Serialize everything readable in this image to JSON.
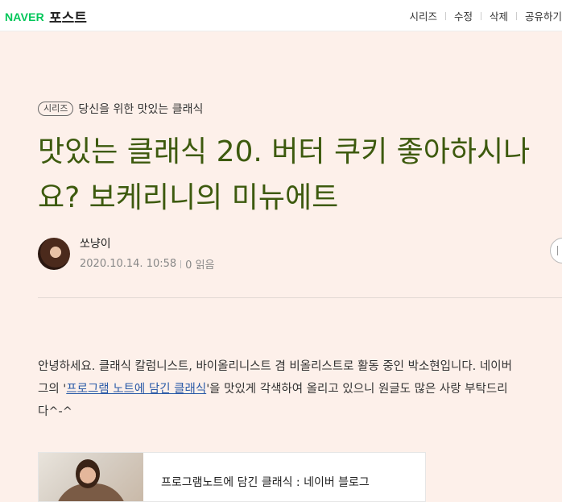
{
  "header": {
    "brand": "NAVER",
    "service": "포스트",
    "nav": [
      "시리즈",
      "수정",
      "삭제",
      "공유하기"
    ]
  },
  "series": {
    "tag": "시리즈",
    "name": "당신을 위한 맛있는 클래식"
  },
  "title": {
    "line1": "맛있는 클래식 20. 버터 쿠키 좋아하시나",
    "line2": "요? 보케리니의 미뉴에트"
  },
  "author": {
    "name": "쏘냥이",
    "datetime": "2020.10.14. 10:58",
    "views": "0 읽음"
  },
  "body": {
    "line1": "안녕하세요. 클래식 칼럼니스트, 바이올리니스트 겸 비올리스트로 활동 중인 박소현입니다. 네이버",
    "line2_before": "그의 '",
    "line2_link": "프로그램 노트에 담긴 클래식",
    "line2_after": "'을 맛있게 각색하여 올리고 있으니 원글도 많은 사랑 부탁드리",
    "line3": "다^-^"
  },
  "card": {
    "title": "프로그램노트에 담긴 클래식 : 네이버 블로그"
  }
}
